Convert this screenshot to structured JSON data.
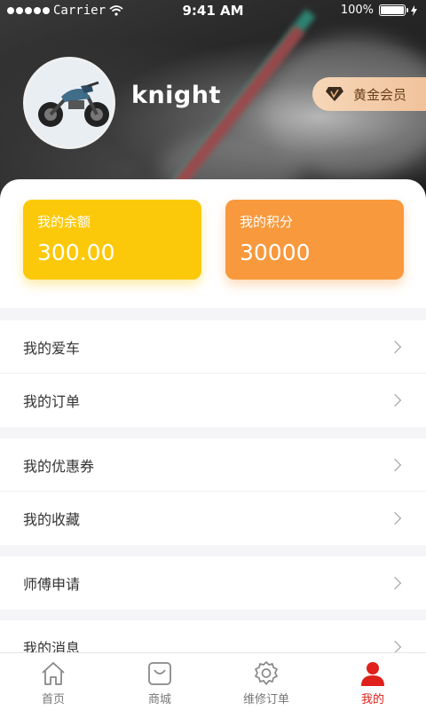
{
  "status_bar": {
    "carrier": "Carrier",
    "time": "9:41 AM",
    "battery": "100%"
  },
  "profile": {
    "username": "knight",
    "member_level": "黄金会员"
  },
  "wallet": {
    "balance_label": "我的余额",
    "balance_value": "300.00",
    "points_label": "我的积分",
    "points_value": "30000"
  },
  "menu": [
    [
      "我的爱车",
      "我的订单"
    ],
    [
      "我的优惠券",
      "我的收藏"
    ],
    [
      "师傅申请"
    ],
    [
      "我的消息"
    ]
  ],
  "tabbar": {
    "items": [
      {
        "label": "首页",
        "icon": "home-icon",
        "active": false
      },
      {
        "label": "商城",
        "icon": "shop-icon",
        "active": false
      },
      {
        "label": "维修订单",
        "icon": "gear-icon",
        "active": false
      },
      {
        "label": "我的",
        "icon": "user-icon",
        "active": true
      }
    ]
  },
  "colors": {
    "balance_card": "#fcc90a",
    "points_card": "#f8993d",
    "active_tab": "#e0201a",
    "member_badge": "#f1c39c"
  }
}
